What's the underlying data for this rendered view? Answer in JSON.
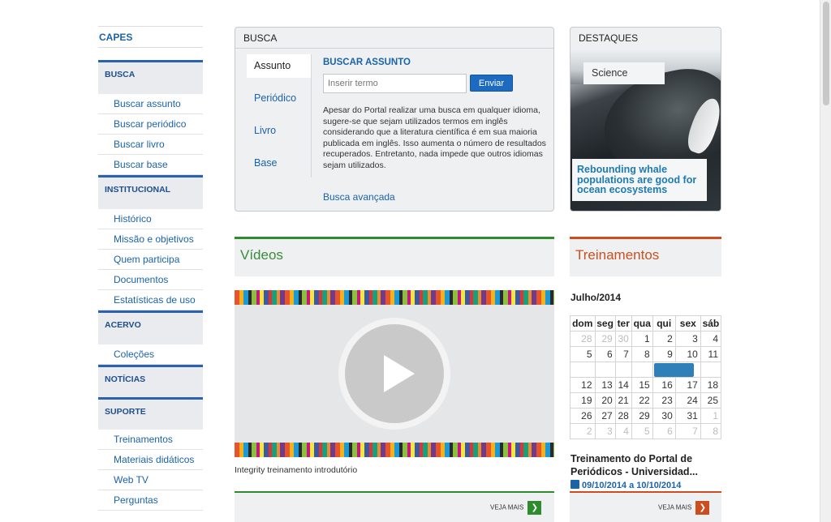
{
  "sidebar": {
    "capes": "CAPES",
    "sections": [
      {
        "title": "BUSCA",
        "items": [
          "Buscar assunto",
          "Buscar periódico",
          "Buscar livro",
          "Buscar base"
        ]
      },
      {
        "title": "INSTITUCIONAL",
        "items": [
          "Histórico",
          "Missão e objetivos",
          "Quem participa",
          "Documentos",
          "Estatísticas de uso"
        ]
      },
      {
        "title": "ACERVO",
        "items": [
          "Coleções"
        ]
      },
      {
        "title": "NOTÍCIAS",
        "items": []
      },
      {
        "title": "SUPORTE",
        "items": [
          "Treinamentos",
          "Materiais didáticos",
          "Web TV",
          "Perguntas"
        ]
      }
    ]
  },
  "busca": {
    "header": "BUSCA",
    "tabs": [
      "Assunto",
      "Periódico",
      "Livro",
      "Base"
    ],
    "title": "BUSCAR ASSUNTO",
    "placeholder": "Inserir termo",
    "button": "Enviar",
    "text": "Apesar do Portal realizar uma busca em qualquer idioma, sugere-se que sejam utilizados termos em inglês considerando que a literatura científica é em sua maioria publicada em inglês. Isso aumenta o número de resultados recuperados. Entretanto, nada impede que outros idiomas sejam utilizados.",
    "advanced": "Busca avançada"
  },
  "destaques": {
    "header": "DESTAQUES",
    "label": "Science",
    "caption": "Rebounding whale populations are good for ocean ecosystems"
  },
  "videos": {
    "header": "Vídeos",
    "caption": "Integrity treinamento introdutório",
    "more": "VEJA MAIS"
  },
  "treinamentos": {
    "header": "Treinamentos",
    "month": "Julho/2014",
    "weekdays": [
      "dom",
      "seg",
      "ter",
      "qua",
      "qui",
      "sex",
      "sáb"
    ],
    "weeks": [
      [
        "28",
        "29",
        "30",
        "1",
        "2",
        "3",
        "4"
      ],
      [
        "5",
        "6",
        "7",
        "8",
        "9",
        "10",
        "11"
      ],
      [
        "12",
        "13",
        "14",
        "15",
        "16",
        "17",
        "18"
      ],
      [
        "19",
        "20",
        "21",
        "22",
        "23",
        "24",
        "25"
      ],
      [
        "26",
        "27",
        "28",
        "29",
        "30",
        "31",
        "1"
      ],
      [
        "2",
        "3",
        "4",
        "5",
        "6",
        "7",
        "8"
      ]
    ],
    "event_title": "Treinamento do Portal de Periódicos - Universidad...",
    "event_date": "09/10/2014 a 10/10/2014",
    "more": "VEJA MAIS"
  },
  "colors": {
    "link_blue": "#1a63a8",
    "section_blue": "#2b62ad",
    "videos_green": "#2e8b2e",
    "treinamentos_orange": "#cc4d1f",
    "event_blue": "#2f80b8"
  }
}
